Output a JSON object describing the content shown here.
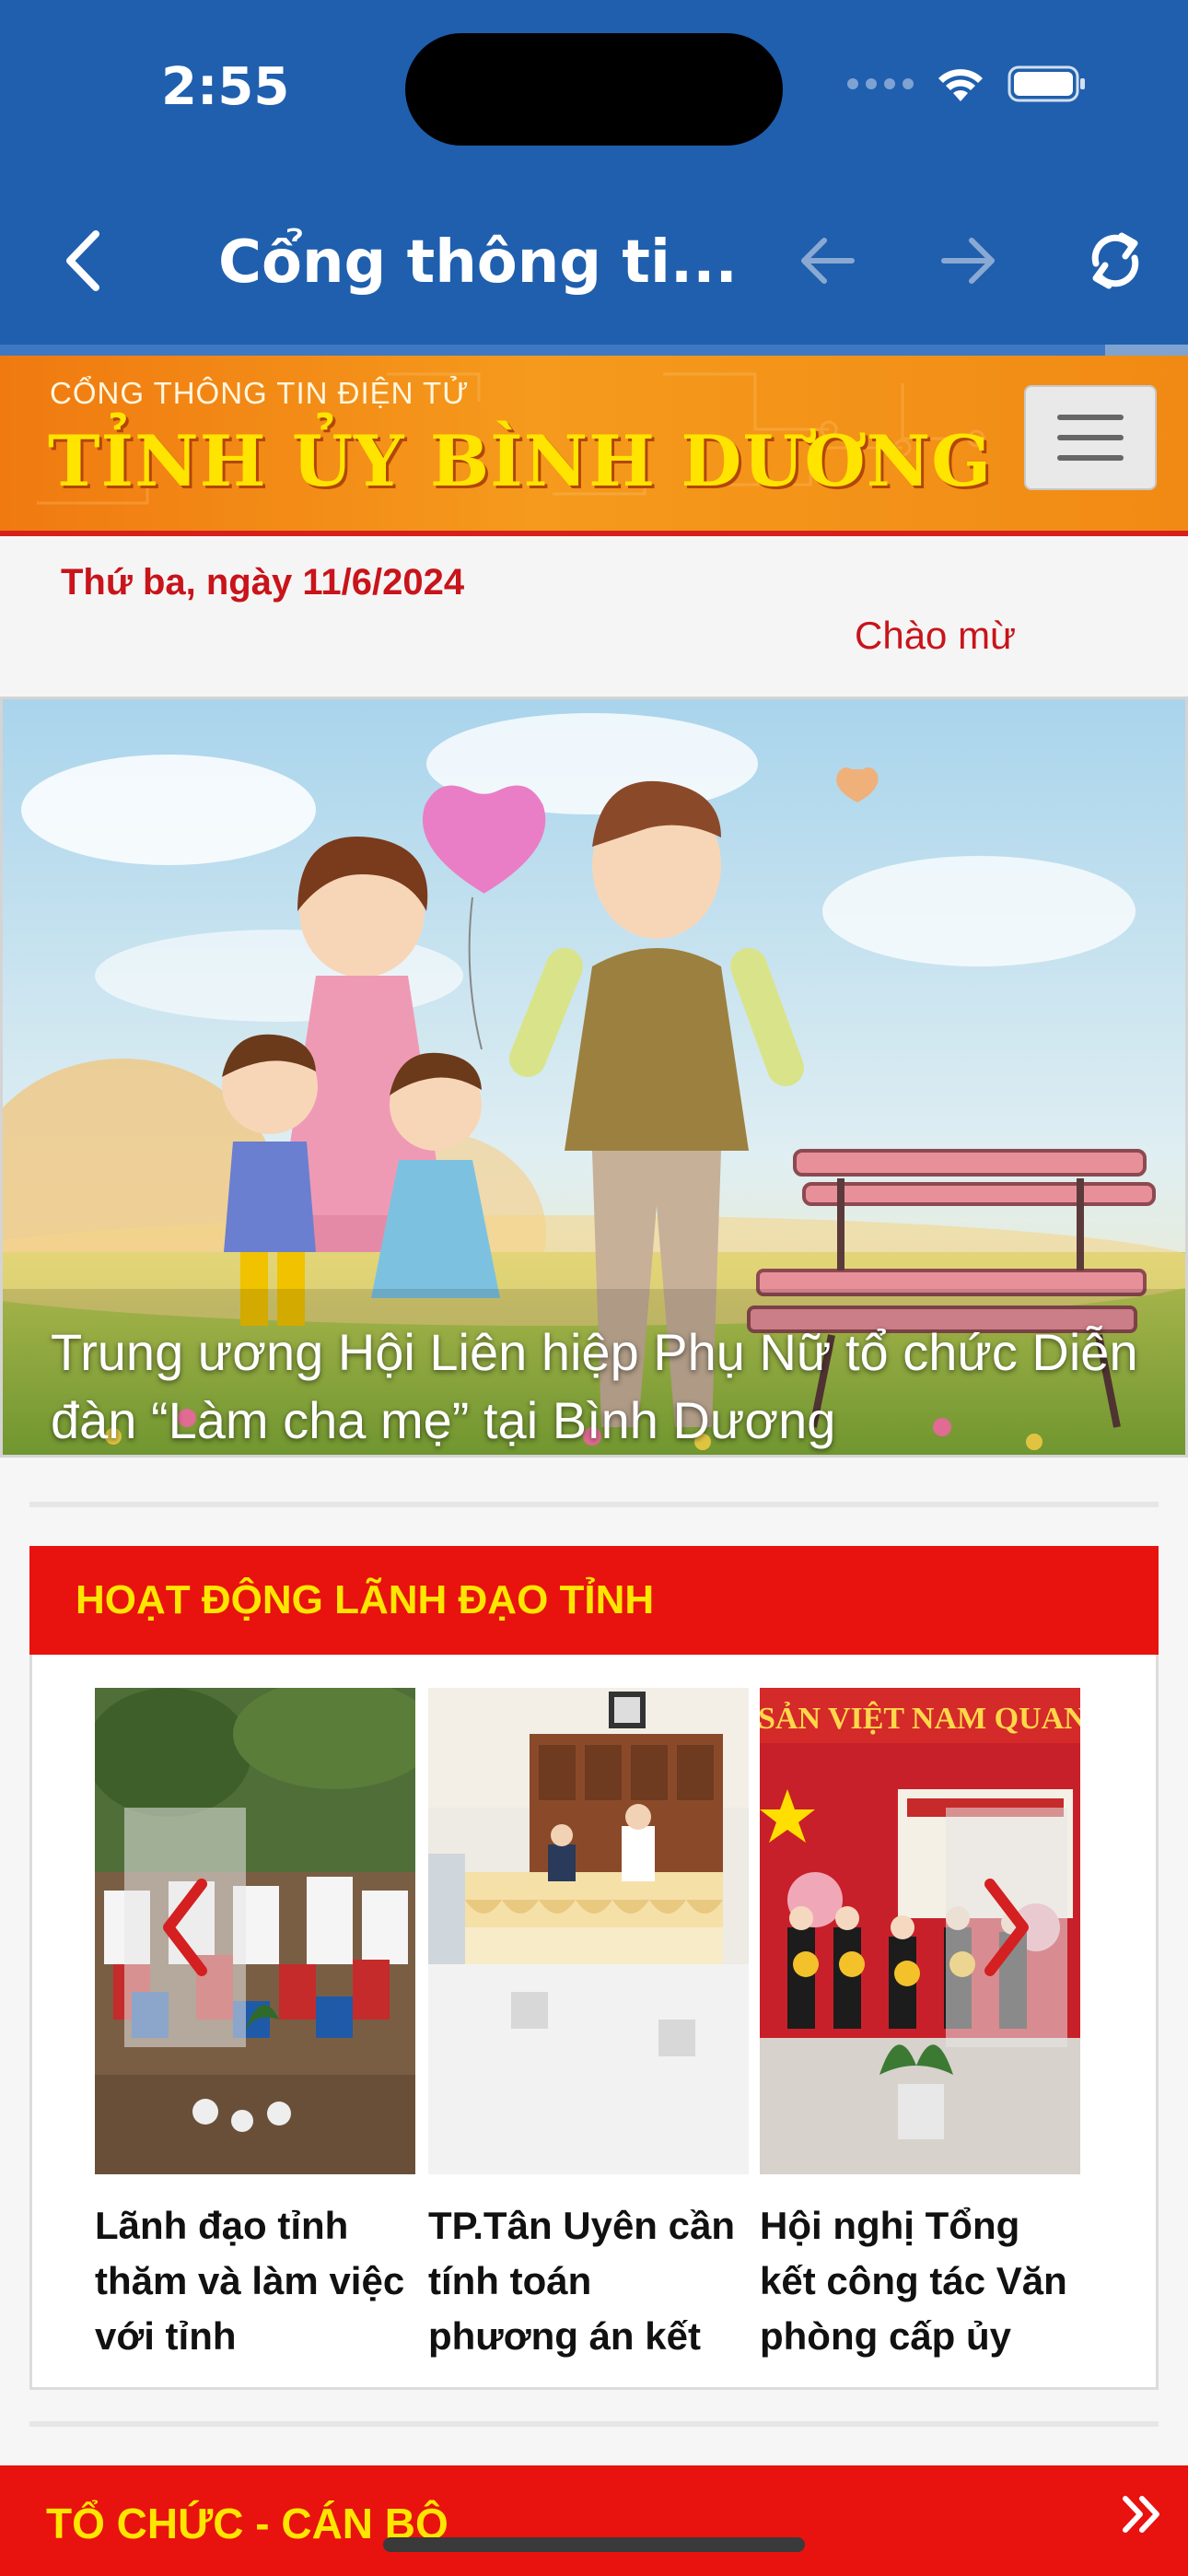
{
  "status_bar": {
    "time": "2:55"
  },
  "nav_bar": {
    "title": "Cổng thông ti...",
    "back_icon": "chevron-left-icon",
    "prev_icon": "arrow-left-icon",
    "next_icon": "arrow-right-icon",
    "reload_icon": "refresh-icon",
    "load_progress": 0.93
  },
  "site_banner": {
    "small_title": "CỔNG THÔNG TIN ĐIỆN TỬ",
    "big_title": "TỈNH ỦY BÌNH DƯƠNG",
    "menu_icon": "hamburger-icon"
  },
  "date_bar": {
    "date": "Thứ ba, ngày 11/6/2024",
    "greeting": "Chào mừ"
  },
  "hero": {
    "caption": "Trung ương Hội Liên hiệp Phụ Nữ tổ chức Diễn đàn “Làm cha mẹ” tại Bình Dương"
  },
  "leadership_section": {
    "title": "HOẠT ĐỘNG LÃNH ĐẠO TỈNH",
    "cards": [
      {
        "title": "Lãnh đạo tỉnh thăm và làm việc với tỉnh"
      },
      {
        "title": "TP.Tân Uyên cần tính toán phương án kết"
      },
      {
        "title": "Hội nghị Tổng kết công tác Văn phòng cấp ủy"
      }
    ],
    "card3_image_text": "SẢN VIỆT NAM QUANG V"
  },
  "next_section": {
    "title": "TỔ CHỨC - CÁN BỘ",
    "more_icon": "double-chevron-right-icon"
  },
  "colors": {
    "nav_blue": "#1f5fae",
    "brand_red": "#e8120f",
    "heading_yellow": "#ffe600",
    "date_red": "#c8141a"
  }
}
